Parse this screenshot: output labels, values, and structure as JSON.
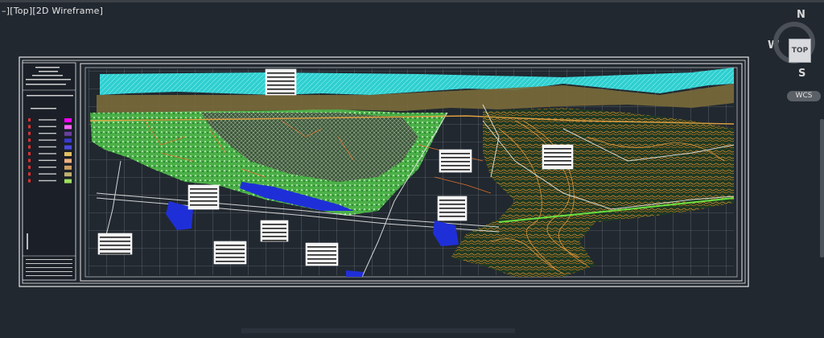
{
  "viewport": {
    "control": "–]",
    "view": "[Top]",
    "style": "[2D Wireframe]"
  },
  "viewcube": {
    "face_label": "TOP",
    "north": "N",
    "south": "S",
    "west": "W"
  },
  "wcs": {
    "label": "WCS"
  },
  "colors": {
    "background": "#212830",
    "sea": "#2fcfd0",
    "vegetation": "#3fe04b",
    "contours": "#e08a2a",
    "water": "#1f2fd8",
    "grid": "#c9cdd3"
  },
  "legend_swatches": [
    "#ff00ff",
    "#ff66ff",
    "#6a3fa0",
    "#3a3ad0",
    "#4a4ae0",
    "#e0c060",
    "#f0b080",
    "#d0a060",
    "#c0b070",
    "#a0e060"
  ]
}
